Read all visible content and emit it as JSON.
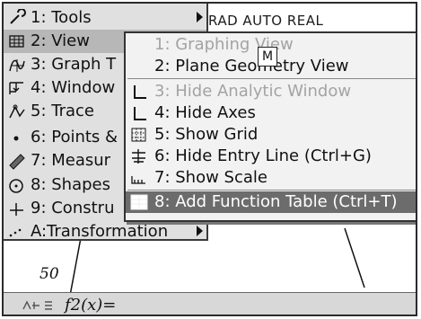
{
  "status": "RAD AUTO REAL",
  "main_menu": [
    {
      "label": "1: Tools",
      "icon": "wrench-icon",
      "submenu": true,
      "selected": false
    },
    {
      "label": "2: View",
      "icon": "grid-view-icon",
      "submenu": true,
      "selected": true
    },
    {
      "label": "3: Graph T",
      "icon": "graph-type-icon",
      "submenu": false,
      "selected": false
    },
    {
      "label": "4: Window",
      "icon": "window-zoom-icon",
      "submenu": false,
      "selected": false
    },
    {
      "label": "5: Trace",
      "icon": "trace-icon",
      "submenu": false,
      "selected": false
    },
    {
      "label": "6: Points &",
      "icon": "point-icon",
      "submenu": false,
      "selected": false
    },
    {
      "label": "7: Measur",
      "icon": "ruler-icon",
      "submenu": false,
      "selected": false
    },
    {
      "label": "8: Shapes",
      "icon": "shapes-icon",
      "submenu": false,
      "selected": false
    },
    {
      "label": "9: Constru",
      "icon": "construction-icon",
      "submenu": false,
      "selected": false
    },
    {
      "label": "A:Transformation",
      "icon": "transformation-icon",
      "submenu": true,
      "selected": false
    }
  ],
  "view_submenu": [
    {
      "label": "1: Graphing View",
      "icon": "",
      "disabled": true,
      "selected": false
    },
    {
      "label": "2: Plane Geometry View",
      "icon": "",
      "disabled": false,
      "selected": false
    },
    {
      "label": "3: Hide Analytic Window",
      "icon": "axes-icon",
      "disabled": true,
      "selected": false
    },
    {
      "label": "4: Hide Axes",
      "icon": "axes-icon",
      "disabled": false,
      "selected": false
    },
    {
      "label": "5: Show Grid",
      "icon": "grid-icon",
      "disabled": false,
      "selected": false
    },
    {
      "label": "6: Hide Entry Line (Ctrl+G)",
      "icon": "entry-line-icon",
      "disabled": false,
      "selected": false
    },
    {
      "label": "7: Show Scale",
      "icon": "scale-icon",
      "disabled": false,
      "selected": false
    },
    {
      "label": "8: Add Function Table (Ctrl+T)",
      "icon": "function-table-icon",
      "disabled": false,
      "selected": true
    }
  ],
  "cursor_badge": "M",
  "axis_label": "50",
  "entry_line": {
    "text": "f2(x)=",
    "icon": "entry-icon"
  },
  "colors": {
    "menu_bg": "#e0e0e0",
    "submenu_bg": "#f2f2f2",
    "selected_dark": "#6c6c6c",
    "selected_light": "#b7b7b7",
    "disabled": "#a3a3a3"
  }
}
